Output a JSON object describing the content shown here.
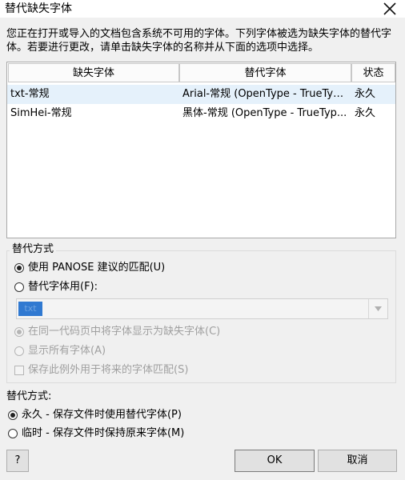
{
  "window": {
    "title": "替代缺失字体"
  },
  "description": "您正在打开或导入的文档包含系统不可用的字体。下列字体被选为缺失字体的替代字体。若要进行更改，请单击缺失字体的名称并从下面的选项中选择。",
  "table": {
    "headers": [
      "缺失字体",
      "替代字体",
      "状态"
    ],
    "rows": [
      {
        "missing": "txt-常规",
        "substitute": "Arial-常规 (OpenType - TrueTyp...",
        "status": "永久",
        "selected": true
      },
      {
        "missing": "SimHei-常规",
        "substitute": "黑体-常规 (OpenType - TrueTyp...",
        "status": "永久",
        "selected": false
      }
    ]
  },
  "substitution_group": {
    "label": "替代方式",
    "option_panose": "使用 PANOSE 建议的匹配(U)",
    "option_substitute": "替代字体用(F):",
    "combo_value": "txt",
    "option_same_codepage": "在同一代码页中将字体显示为缺失字体(C)",
    "option_show_all": "显示所有字体(A)",
    "checkbox_save_exception": "保存此例外用于将来的字体匹配(S)"
  },
  "mode": {
    "label": "替代方式:",
    "option_permanent": "永久 - 保存文件时使用替代字体(P)",
    "option_temporary": "临时 - 保存文件时保持原来字体(M)"
  },
  "buttons": {
    "help": "?",
    "ok": "OK",
    "cancel": "取消"
  }
}
